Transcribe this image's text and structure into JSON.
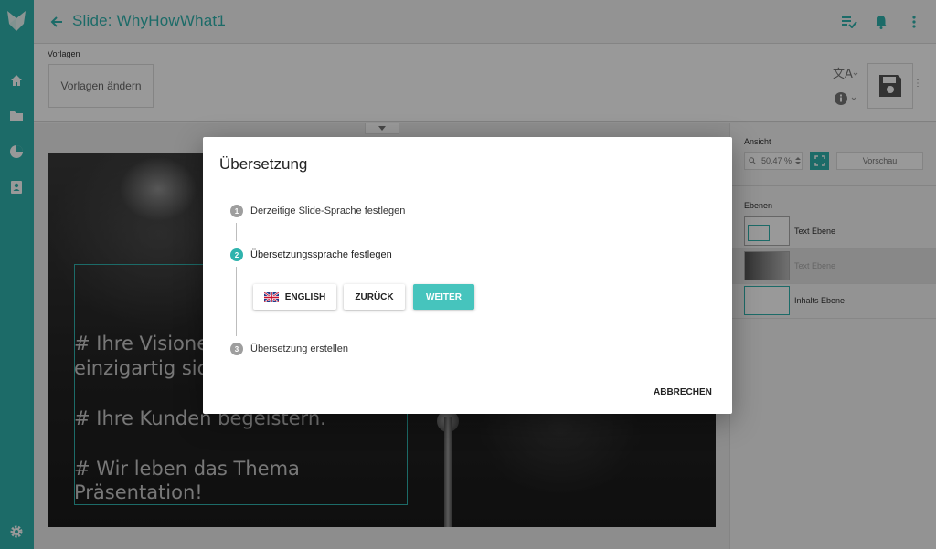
{
  "header": {
    "title": "Slide: WhyHowWhat1"
  },
  "toolbar": {
    "templates_label": "Vorlagen",
    "change_templates": "Vorlagen ändern"
  },
  "canvas": {
    "lines": [
      "# Ihre Visionen",
      "einzigartig sichtbar",
      "# Ihre Kunden begeistern.",
      "# Wir leben das Thema",
      "Präsentation!"
    ]
  },
  "right_panel": {
    "view_label": "Ansicht",
    "zoom_value": "50.47 %",
    "preview_label": "Vorschau",
    "layers_label": "Ebenen",
    "layers": [
      {
        "name": "Text Ebene"
      },
      {
        "name": "Text Ebene"
      },
      {
        "name": "Inhalts Ebene"
      }
    ]
  },
  "dialog": {
    "title": "Übersetzung",
    "steps": [
      {
        "number": "1",
        "label": "Derzeitige Slide-Sprache festlegen"
      },
      {
        "number": "2",
        "label": "Übersetzungssprache festlegen"
      },
      {
        "number": "3",
        "label": "Übersetzung erstellen"
      }
    ],
    "language_button": "ENGLISH",
    "back_button": "ZURÜCK",
    "next_button": "WEITER",
    "cancel_button": "ABBRECHEN"
  },
  "colors": {
    "accent": "#2fb3ad",
    "primary_button": "#46c4bd"
  }
}
